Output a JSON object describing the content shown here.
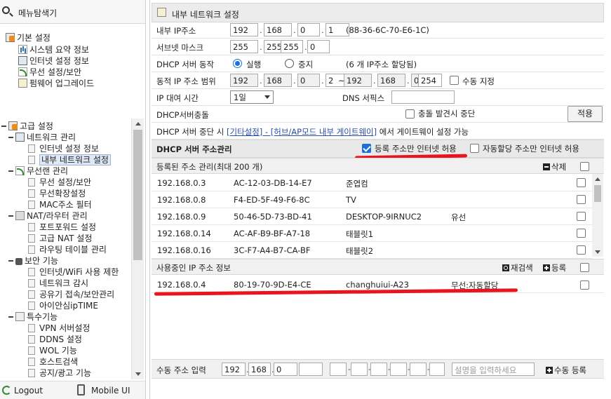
{
  "sidebar": {
    "title": "메뉴탐색기",
    "basic_group": {
      "label": "기본 설정",
      "items": [
        {
          "label": "시스템 요약 정보",
          "icon": "chart-icon"
        },
        {
          "label": "인터넷 설정 정보",
          "icon": "network-icon"
        },
        {
          "label": "무선 설정/보안",
          "icon": "wifi-icon"
        },
        {
          "label": "펌웨어 업그레이드",
          "icon": "firmware-icon"
        }
      ]
    },
    "advanced_group": {
      "label": "고급 설정",
      "network": {
        "label": "네트워크 관리",
        "items": [
          "인터넷 설정 정보",
          "내부 네트워크 설정"
        ]
      },
      "wireless": {
        "label": "무선랜 관리",
        "items": [
          "무선 설정/보안",
          "무선확장설정",
          "MAC주소 필터"
        ]
      },
      "nat": {
        "label": "NAT/라우터 관리",
        "items": [
          "포트포워드 설정",
          "고급 NAT 설정",
          "라우팅 테이블 관리"
        ]
      },
      "security": {
        "label": "보안 기능",
        "items": [
          "인터넷/WiFi 사용 제한",
          "네트워크 감시",
          "공유기 접속/보안관리",
          "아이안심ipTIME"
        ]
      },
      "special": {
        "label": "특수기능",
        "items": [
          "VPN 서버설정",
          "DDNS 설정",
          "WOL 기능",
          "호스트검색",
          "공지/광고 기능"
        ]
      }
    },
    "selected_item": "내부 네트워크 설정",
    "footer": {
      "logout": "Logout",
      "mobile": "Mobile UI"
    }
  },
  "main": {
    "title": "내부 네트워크 설정",
    "internal_ip": {
      "label": "내부 IP주소",
      "octets": [
        "192",
        "168",
        "0",
        "1"
      ],
      "mac": "(88-36-6C-70-E6-1C)"
    },
    "subnet": {
      "label": "서브넷 마스크",
      "octets": [
        "255",
        "255",
        "255",
        "0"
      ]
    },
    "dhcp": {
      "label": "DHCP 서버 동작",
      "run": "실행",
      "stop": "중지",
      "selected": "실행",
      "info": "(6 개 IP주소 할당됨)"
    },
    "range": {
      "label": "동적 IP 주소 범위",
      "start": [
        "192",
        "168",
        "0",
        "2"
      ],
      "sep": "~",
      "end": [
        "192",
        "168",
        "0",
        "254"
      ],
      "manual": "수동 지정"
    },
    "lease": {
      "label": "IP 대여 시간",
      "value": "1일",
      "dns_label": "DNS 서픽스",
      "dns_value": ""
    },
    "conflict": {
      "label": "DHCP서버충돌",
      "check_label": "충돌 발견시 중단",
      "apply": "적용"
    },
    "stop_note": {
      "prefix": "DHCP 서버 중단 시 ",
      "link": "[기타설정] - [허브/AP모드 내부 게이트웨이]",
      "suffix": " 에서 게이트웨이 설정 가능"
    },
    "mgmt": {
      "title": "DHCP 서버 주소관리",
      "opt1": "등록 주소만 인터넷 허용",
      "opt1_checked": true,
      "opt2": "자동할당 주소만 인터넷 허용",
      "opt2_checked": false
    },
    "registered": {
      "title": "등록된 주소 관리(최대 200 개)",
      "delete": "삭제",
      "rows": [
        {
          "ip": "192.168.0.3",
          "mac": "AC-12-03-DB-14-E7",
          "name": "준엽컴",
          "type": ""
        },
        {
          "ip": "192.168.0.8",
          "mac": "F4-ED-5F-49-F6-8C",
          "name": "TV",
          "type": ""
        },
        {
          "ip": "192.168.0.9",
          "mac": "50-46-5D-73-BD-41",
          "name": "DESKTOP-9IRNUC2",
          "type": "유선"
        },
        {
          "ip": "192.168.0.14",
          "mac": "AC-AF-B9-BF-A7-18",
          "name": "태블릿1",
          "type": ""
        },
        {
          "ip": "192.168.0.16",
          "mac": "3C-F7-A4-B7-CA-BF",
          "name": "태블릿2",
          "type": ""
        }
      ]
    },
    "in_use": {
      "title": "사용중인 IP 주소 정보",
      "rescan": "재검색",
      "register": "등록",
      "rows": [
        {
          "ip": "192.168.0.4",
          "mac": "80-19-70-9D-E4-CE",
          "name": "changhuiui-A23",
          "type": "무선:자동할당"
        }
      ]
    },
    "manual_entry": {
      "label": "수동 주소 입력",
      "ip": [
        "192",
        "168",
        "0",
        ""
      ],
      "mac": [
        "",
        "",
        "",
        "",
        "",
        ""
      ],
      "desc_placeholder": "설명을 입력하세요",
      "add": "수동 등록"
    }
  },
  "colors": {
    "accent": "#1a6fd8",
    "highlight_underline": "#e8141e",
    "link": "#2a4fa8"
  }
}
